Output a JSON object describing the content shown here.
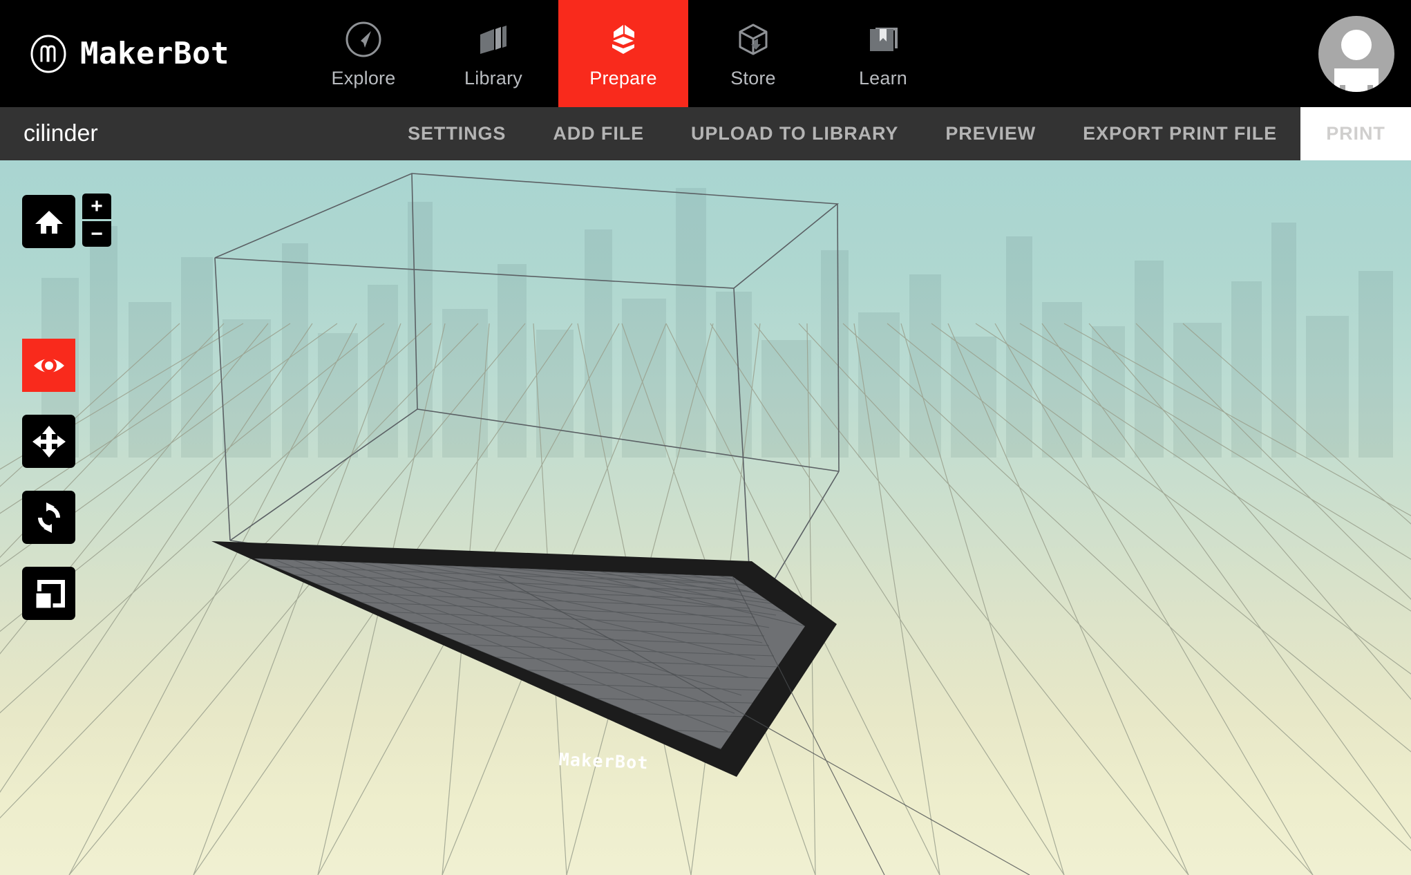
{
  "app": {
    "brand_name": "MakerBot",
    "brand_logo_icon": "makerbot-m-logo-icon",
    "accent_color": "#f92a1c",
    "header_bg": "#000000",
    "subbar_bg": "#333333"
  },
  "nav": {
    "items": [
      {
        "label": "Explore",
        "icon": "compass-icon",
        "active": false
      },
      {
        "label": "Library",
        "icon": "layers-icon",
        "active": false
      },
      {
        "label": "Prepare",
        "icon": "prepare-cube-icon",
        "active": true
      },
      {
        "label": "Store",
        "icon": "box-download-icon",
        "active": false
      },
      {
        "label": "Learn",
        "icon": "book-bookmark-icon",
        "active": false
      }
    ],
    "avatar_icon": "user-avatar-icon"
  },
  "subbar": {
    "project_name": "cilinder",
    "actions": [
      {
        "label": "SETTINGS",
        "name": "settings",
        "disabled": false
      },
      {
        "label": "ADD FILE",
        "name": "add-file",
        "disabled": false
      },
      {
        "label": "UPLOAD TO LIBRARY",
        "name": "upload-to-library",
        "disabled": false
      },
      {
        "label": "PREVIEW",
        "name": "preview",
        "disabled": false
      },
      {
        "label": "EXPORT PRINT FILE",
        "name": "export-print-file",
        "disabled": false
      },
      {
        "label": "PRINT",
        "name": "print",
        "disabled": true
      }
    ]
  },
  "toolrail": {
    "home_icon": "home-icon",
    "zoom_in_label": "+",
    "zoom_out_label": "−",
    "tools": [
      {
        "name": "view-tool",
        "icon": "eye-icon",
        "active": true
      },
      {
        "name": "move-tool",
        "icon": "move-arrows-icon",
        "active": false
      },
      {
        "name": "rotate-tool",
        "icon": "rotate-arrows-icon",
        "active": false
      },
      {
        "name": "scale-tool",
        "icon": "scale-squares-icon",
        "active": false
      }
    ]
  },
  "viewport": {
    "build_plate_label": "MakerBot",
    "build_plate_surface_color": "#6e7073",
    "build_plate_border_color": "#1c1c1c",
    "build_volume_wireframe_color": "#5b6064",
    "ground_grid_color": "#9aa08d",
    "background_top_color": "#a9d5d1",
    "background_bottom_color": "#f0f0d2"
  }
}
